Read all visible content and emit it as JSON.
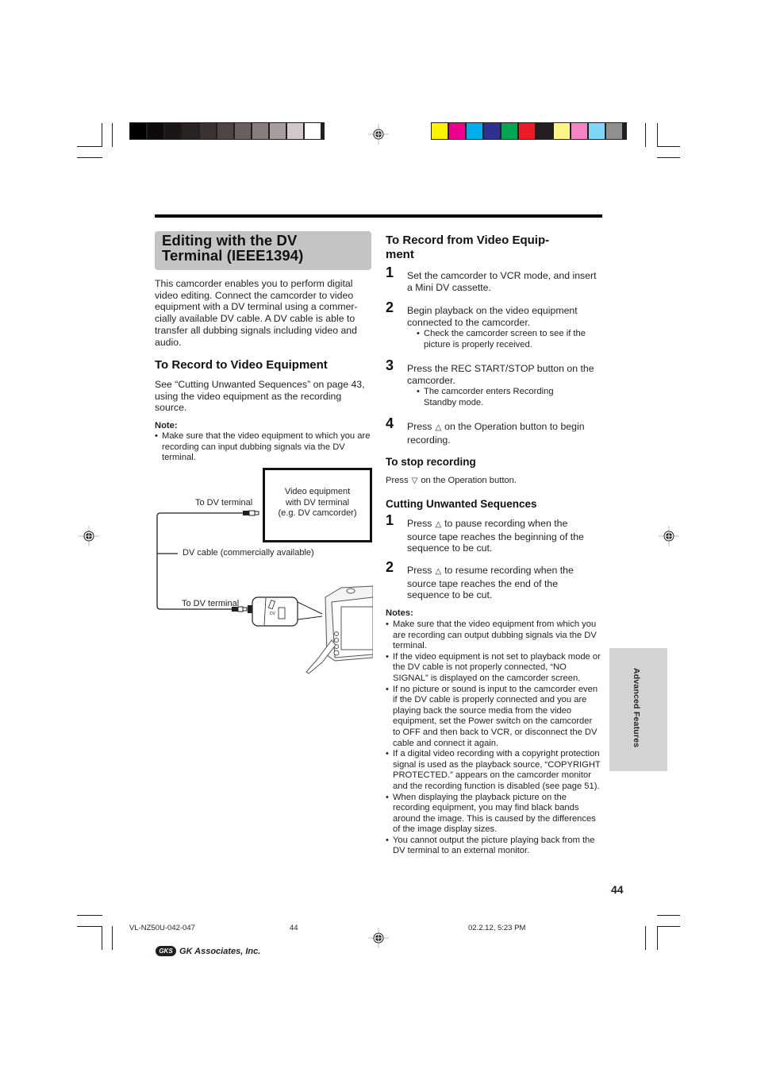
{
  "color_bars": {
    "grayscale": [
      "#000000",
      "#0c0a0a",
      "#1a1615",
      "#282221",
      "#3a3230",
      "#4f4644",
      "#6a605d",
      "#877d7a",
      "#a69e9c",
      "#d1c9c8",
      "#ffffff"
    ],
    "process": [
      "#fff200",
      "#ec008c",
      "#00aeef",
      "#2e3192",
      "#00a651",
      "#ed1c24",
      "#231f20",
      "#fff685",
      "#f683c5",
      "#7fd7f7",
      "#8f8f8f"
    ]
  },
  "title": {
    "line1": "Editing with the DV",
    "line2": "Terminal (IEEE1394)"
  },
  "intro": "This camcorder enables you to perform digital video editing. Connect the camcorder to video equipment with a DV terminal using a commer-cially available DV cable. A DV cable is able to transfer all dubbing signals including video and audio.",
  "record_to": {
    "heading": "To Record to Video Equipment",
    "text": "See “Cutting Unwanted Sequences” on page 43, using the video equipment as the recording source.",
    "note_title": "Note:",
    "note": "Make sure that the video equipment to which you are recording can input dubbing signals via the DV terminal."
  },
  "diagram": {
    "box_line1": "Video equipment",
    "box_line2": "with DV terminal",
    "box_line3": "(e.g. DV camcorder)",
    "label_top": "To DV terminal",
    "label_cable": "DV cable (commercially available)",
    "label_bottom": "To DV terminal",
    "port_label": "DV"
  },
  "record_from": {
    "heading_line1": "To Record from Video Equip-",
    "heading_line2": "ment",
    "steps": [
      {
        "num": "1",
        "text": "Set the camcorder to VCR mode, and insert a Mini DV cassette."
      },
      {
        "num": "2",
        "text": "Begin playback on the video equipment connected to the camcorder.",
        "sub": "Check the camcorder screen to see if the picture is properly received."
      },
      {
        "num": "3",
        "text": "Press the REC START/STOP button on the camcorder.",
        "sub": "The camcorder enters Recording Standby mode."
      },
      {
        "num": "4",
        "pre": "Press",
        "icon": "△",
        "post": "on the Operation button to begin recording."
      }
    ]
  },
  "stop": {
    "heading": "To stop recording",
    "pre": "Press",
    "icon": "▽",
    "post": "on the Operation button."
  },
  "cutting": {
    "heading": "Cutting Unwanted Sequences",
    "steps": [
      {
        "num": "1",
        "pre": "Press",
        "icon": "△",
        "post": "to pause recording when the source tape reaches the beginning of the sequence to be cut."
      },
      {
        "num": "2",
        "pre": "Press",
        "icon": "△",
        "post": "to resume recording when the source tape reaches the end of the sequence to be cut."
      }
    ]
  },
  "notes": {
    "title": "Notes:",
    "items": [
      "Make sure that the video equipment from which you are recording can output dubbing signals via the DV terminal.",
      "If the video equipment is not set to playback mode or the DV cable is not properly connected, “NO SIGNAL” is displayed on the camcorder screen.",
      "If no picture or sound is input to the camcorder even if the DV cable is properly connected and you are playing back the source media from the video equipment, set the Power switch on the camcorder to OFF and then back to VCR, or disconnect the DV cable and connect it again.",
      "If a digital video recording with a copyright protection signal is used as the playback source, “COPYRIGHT PROTECTED.” appears on the camcorder monitor and the recording function is disabled (see page 51).",
      "When displaying the playback picture on the recording equipment, you may find black bands around the image. This is caused by the differences of the image display sizes.",
      "You cannot output the picture playing back from the DV terminal to an external monitor."
    ]
  },
  "side_tab": "Advanced Features",
  "page_number": "44",
  "footer": {
    "file": "VL-NZ50U-042-047",
    "page": "44",
    "date": "02.2.12, 5:23 PM",
    "logo_mark": "GKS",
    "company": "GK Associates, Inc."
  }
}
